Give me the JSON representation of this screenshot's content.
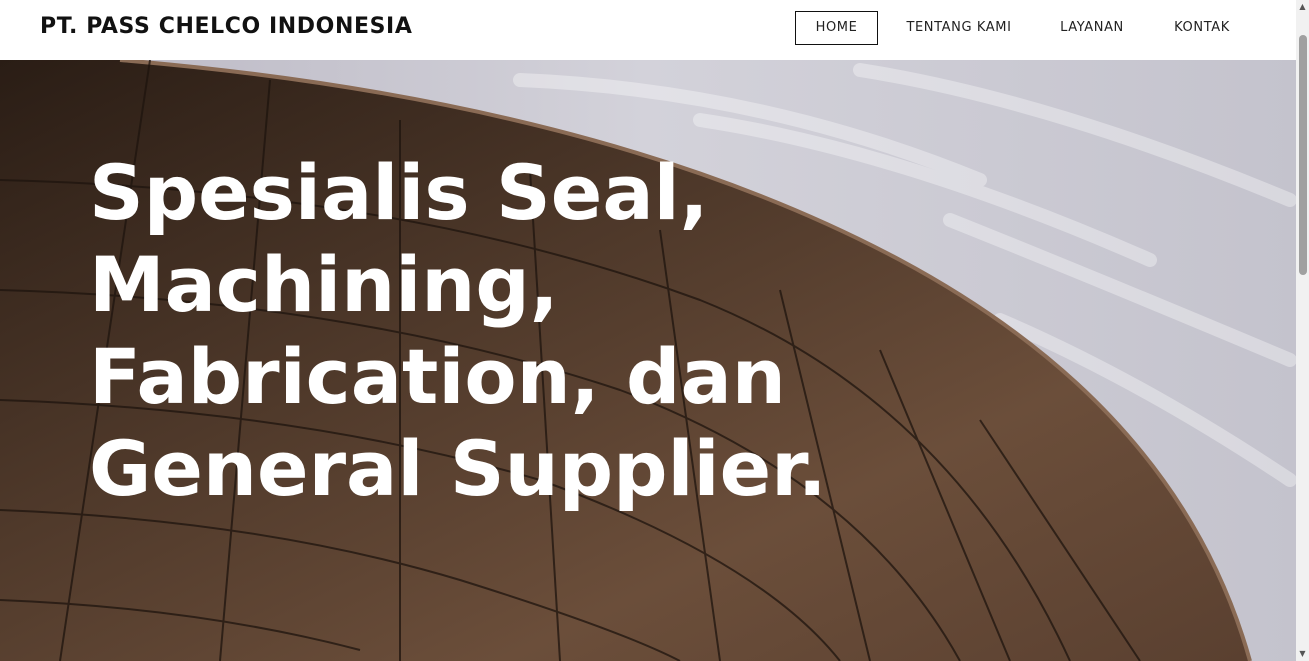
{
  "header": {
    "brand": "PT. PASS CHELCO INDONESIA",
    "nav": [
      {
        "label": "HOME",
        "active": true
      },
      {
        "label": "TENTANG KAMI",
        "active": false
      },
      {
        "label": "LAYANAN",
        "active": false
      },
      {
        "label": "KONTAK",
        "active": false
      }
    ]
  },
  "hero": {
    "headline_lines": [
      "Spesialis Seal,",
      "Machining,",
      "Fabrication, dan",
      "General Supplier."
    ],
    "background": "curved-metal-roof-photo"
  },
  "colors": {
    "text_dark": "#111111",
    "hero_text": "#ffffff",
    "roof_brown": "#4a3526",
    "sky": "#cfcdd6"
  },
  "scrollbar": {
    "up_icon": "triangle-up",
    "down_icon": "triangle-down"
  }
}
